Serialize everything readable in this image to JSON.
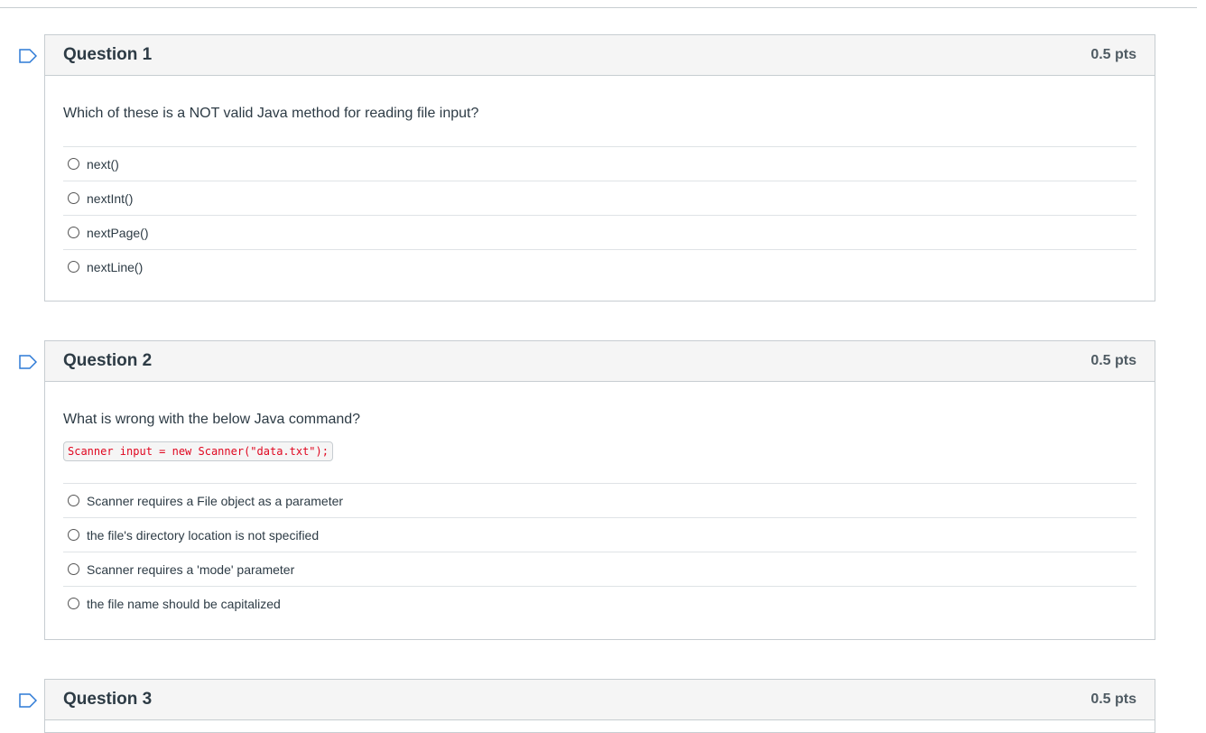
{
  "questions": [
    {
      "title": "Question 1",
      "points": "0.5 pts",
      "text": "Which of these is a NOT valid Java method for reading file input?",
      "code": "",
      "answers": [
        "next()",
        "nextInt()",
        "nextPage()",
        "nextLine()"
      ]
    },
    {
      "title": "Question 2",
      "points": "0.5 pts",
      "text": "What is wrong with the below Java command?",
      "code": "Scanner input = new Scanner(\"data.txt\");",
      "answers": [
        "Scanner requires a File object as a parameter",
        "the file's directory location is not specified",
        "Scanner requires a 'mode' parameter",
        "the file name should be capitalized"
      ]
    },
    {
      "title": "Question 3",
      "points": "0.5 pts"
    }
  ],
  "colors": {
    "header_bg": "#f5f5f5",
    "border": "#c7cdd1",
    "code_text": "#e0061f",
    "flag": "#2d7ad6"
  },
  "icons": {
    "flag": "flag-outline-icon",
    "radio": "radio-unchecked"
  }
}
